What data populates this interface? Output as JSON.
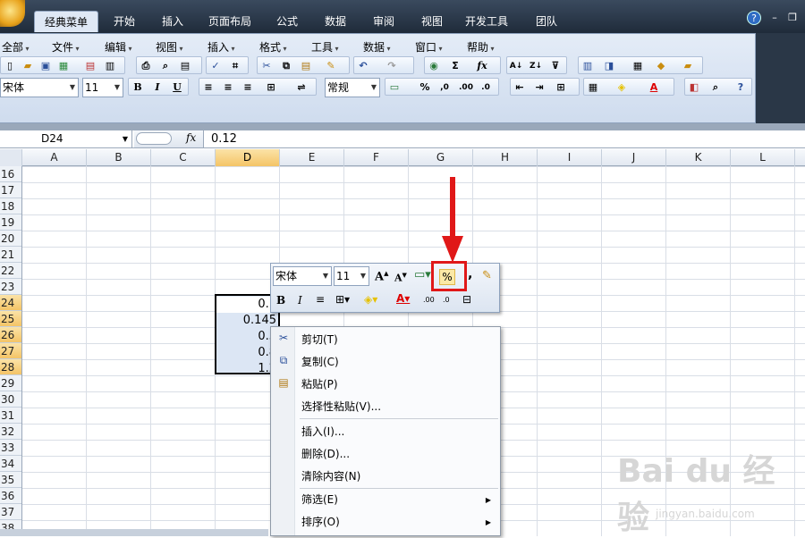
{
  "ribbon": {
    "tabs": [
      "经典菜单",
      "开始",
      "插入",
      "页面布局",
      "公式",
      "数据",
      "审阅",
      "视图",
      "开发工具",
      "团队"
    ],
    "active_tab": "经典菜单",
    "help": "?"
  },
  "menu_bar": [
    "全部",
    "文件",
    "编辑",
    "视图",
    "插入",
    "格式",
    "工具",
    "数据",
    "窗口",
    "帮助"
  ],
  "toolbar": {
    "font_name": "宋体",
    "font_size": "11",
    "bold": "B",
    "italic": "I",
    "underline": "U",
    "number_format": "常规",
    "percent": "%",
    "sigma": "Σ",
    "fx": "fx"
  },
  "formula_bar": {
    "name_box": "D24",
    "fx_label": "fx",
    "value": "0.12"
  },
  "columns": [
    "A",
    "B",
    "C",
    "D",
    "E",
    "F",
    "G",
    "H",
    "I",
    "J",
    "K",
    "L"
  ],
  "selected_column": "D",
  "rows": [
    "16",
    "17",
    "18",
    "19",
    "20",
    "21",
    "22",
    "23",
    "24",
    "25",
    "26",
    "27",
    "28",
    "29",
    "30",
    "31",
    "32",
    "33",
    "34",
    "35",
    "36",
    "37",
    "38"
  ],
  "selected_rows": [
    "24",
    "25",
    "26",
    "27",
    "28"
  ],
  "cells": [
    {
      "ref": "D24",
      "display": "0.1"
    },
    {
      "ref": "D25",
      "display": "0.145"
    },
    {
      "ref": "D26",
      "display": "0.3"
    },
    {
      "ref": "D27",
      "display": "0.8"
    },
    {
      "ref": "D28",
      "display": "1.2"
    }
  ],
  "mini_toolbar": {
    "font_name": "宋体",
    "font_size": "11",
    "percent": "%",
    "comma": ",",
    "bold": "B",
    "italic": "I"
  },
  "context_menu": {
    "items": [
      {
        "label": "剪切(T)",
        "icon": "scissors-icon"
      },
      {
        "label": "复制(C)",
        "icon": "copy-icon"
      },
      {
        "label": "粘贴(P)",
        "icon": "paste-icon"
      },
      {
        "label": "选择性粘贴(V)...",
        "icon": ""
      },
      {
        "label": "插入(I)...",
        "icon": ""
      },
      {
        "label": "删除(D)...",
        "icon": ""
      },
      {
        "label": "清除内容(N)",
        "icon": ""
      },
      {
        "label": "筛选(E)",
        "icon": "",
        "submenu": true
      },
      {
        "label": "排序(O)",
        "icon": "",
        "submenu": true
      }
    ]
  },
  "watermark": {
    "brand": "Bai du 经验",
    "url": "jingyan.baidu.com"
  },
  "colors": {
    "highlight": "#e01818",
    "selected_header": "#f4c466",
    "ribbon_dark": "#1f2b3a"
  }
}
